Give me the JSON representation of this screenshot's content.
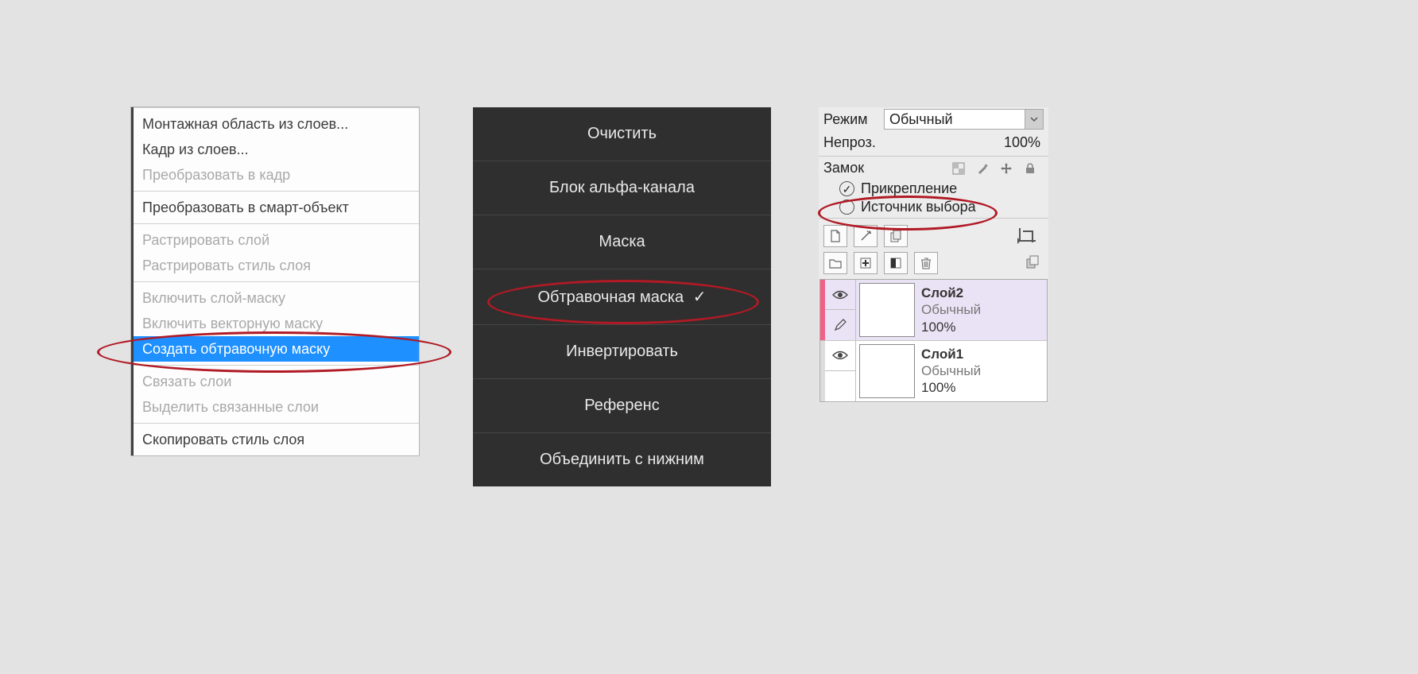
{
  "left_menu": {
    "groups": [
      {
        "items": [
          {
            "label": "Монтажная область из слоев...",
            "disabled": false
          },
          {
            "label": "Кадр из слоев...",
            "disabled": false
          },
          {
            "label": "Преобразовать в кадр",
            "disabled": true
          }
        ]
      },
      {
        "items": [
          {
            "label": "Преобразовать в смарт-объект",
            "disabled": false
          }
        ]
      },
      {
        "items": [
          {
            "label": "Растрировать слой",
            "disabled": true
          },
          {
            "label": "Растрировать стиль слоя",
            "disabled": true
          }
        ]
      },
      {
        "items": [
          {
            "label": "Включить слой-маску",
            "disabled": true
          },
          {
            "label": "Включить векторную маску",
            "disabled": true
          },
          {
            "label": "Создать обтравочную маску",
            "disabled": false,
            "selected": true,
            "circled": true
          }
        ]
      },
      {
        "items": [
          {
            "label": "Связать слои",
            "disabled": true
          },
          {
            "label": "Выделить связанные слои",
            "disabled": true
          }
        ]
      },
      {
        "items": [
          {
            "label": "Скопировать стиль слоя",
            "disabled": false
          }
        ]
      }
    ]
  },
  "dark_menu": {
    "items": [
      {
        "label": "Очистить"
      },
      {
        "label": "Блок альфа-канала"
      },
      {
        "label": "Маска"
      },
      {
        "label": "Обтравочная маска",
        "checked": true,
        "circled": true
      },
      {
        "label": "Инвертировать"
      },
      {
        "label": "Референс"
      },
      {
        "label": "Объединить с нижним"
      }
    ]
  },
  "layers_panel": {
    "mode_label": "Режим",
    "mode_value": "Обычный",
    "opacity_label": "Непроз.",
    "opacity_value": "100%",
    "lock_label": "Замок",
    "lock_icons": [
      "checker-icon",
      "brush-icon",
      "move-icon",
      "lock-icon"
    ],
    "attach_label": "Прикрепление",
    "attach_checked": true,
    "attach_circled": true,
    "selection_source_label": "Источник выбора",
    "selection_source_checked": false,
    "toolbar1_icons": [
      "page-icon",
      "wand-icon",
      "pages-icon",
      "crop-icon"
    ],
    "toolbar2_icons": [
      "folder-icon",
      "add-icon",
      "mask-icon",
      "trash-icon",
      "copy-icon"
    ],
    "layers": [
      {
        "name": "Слой2",
        "mode": "Обычный",
        "opacity": "100%",
        "selected": true,
        "bar": "pink",
        "cells": [
          "eye-icon",
          "pencil-icon"
        ]
      },
      {
        "name": "Слой1",
        "mode": "Обычный",
        "opacity": "100%",
        "selected": false,
        "bar": "grey",
        "cells": [
          "eye-icon",
          "blank"
        ]
      }
    ]
  }
}
